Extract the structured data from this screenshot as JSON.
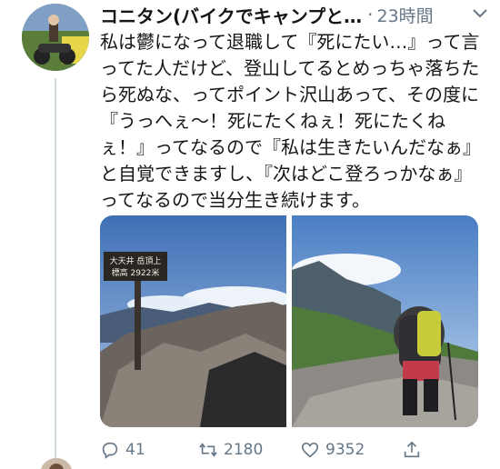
{
  "tweet": {
    "author": "コニタン(バイクでキャンプと…",
    "separator": "·",
    "time": "23時間",
    "text": "私は鬱になって退職して『死にたい…』って言ってた人だけど、登山してるとめっちゃ落ちたら死ぬな、ってポイント沢山あって、その度に『うっへぇ〜！死にたくねぇ！死にたくねぇ！』ってなるので『私は生きたいんだなぁ』と自覚できますし、『次はどこ登ろっかなぁ』ってなるので当分生き続けます。",
    "photo1_sign": {
      "line1": "大天井 岳頂上",
      "line2": "標高 2922米"
    }
  },
  "actions": {
    "replies": "41",
    "retweets": "2180",
    "likes": "9352"
  },
  "icons": [
    "chevron-down-icon",
    "reply-icon",
    "retweet-icon",
    "like-icon",
    "share-icon"
  ],
  "colors": {
    "text": "#14171a",
    "muted": "#657786",
    "line": "#cfd9de"
  }
}
